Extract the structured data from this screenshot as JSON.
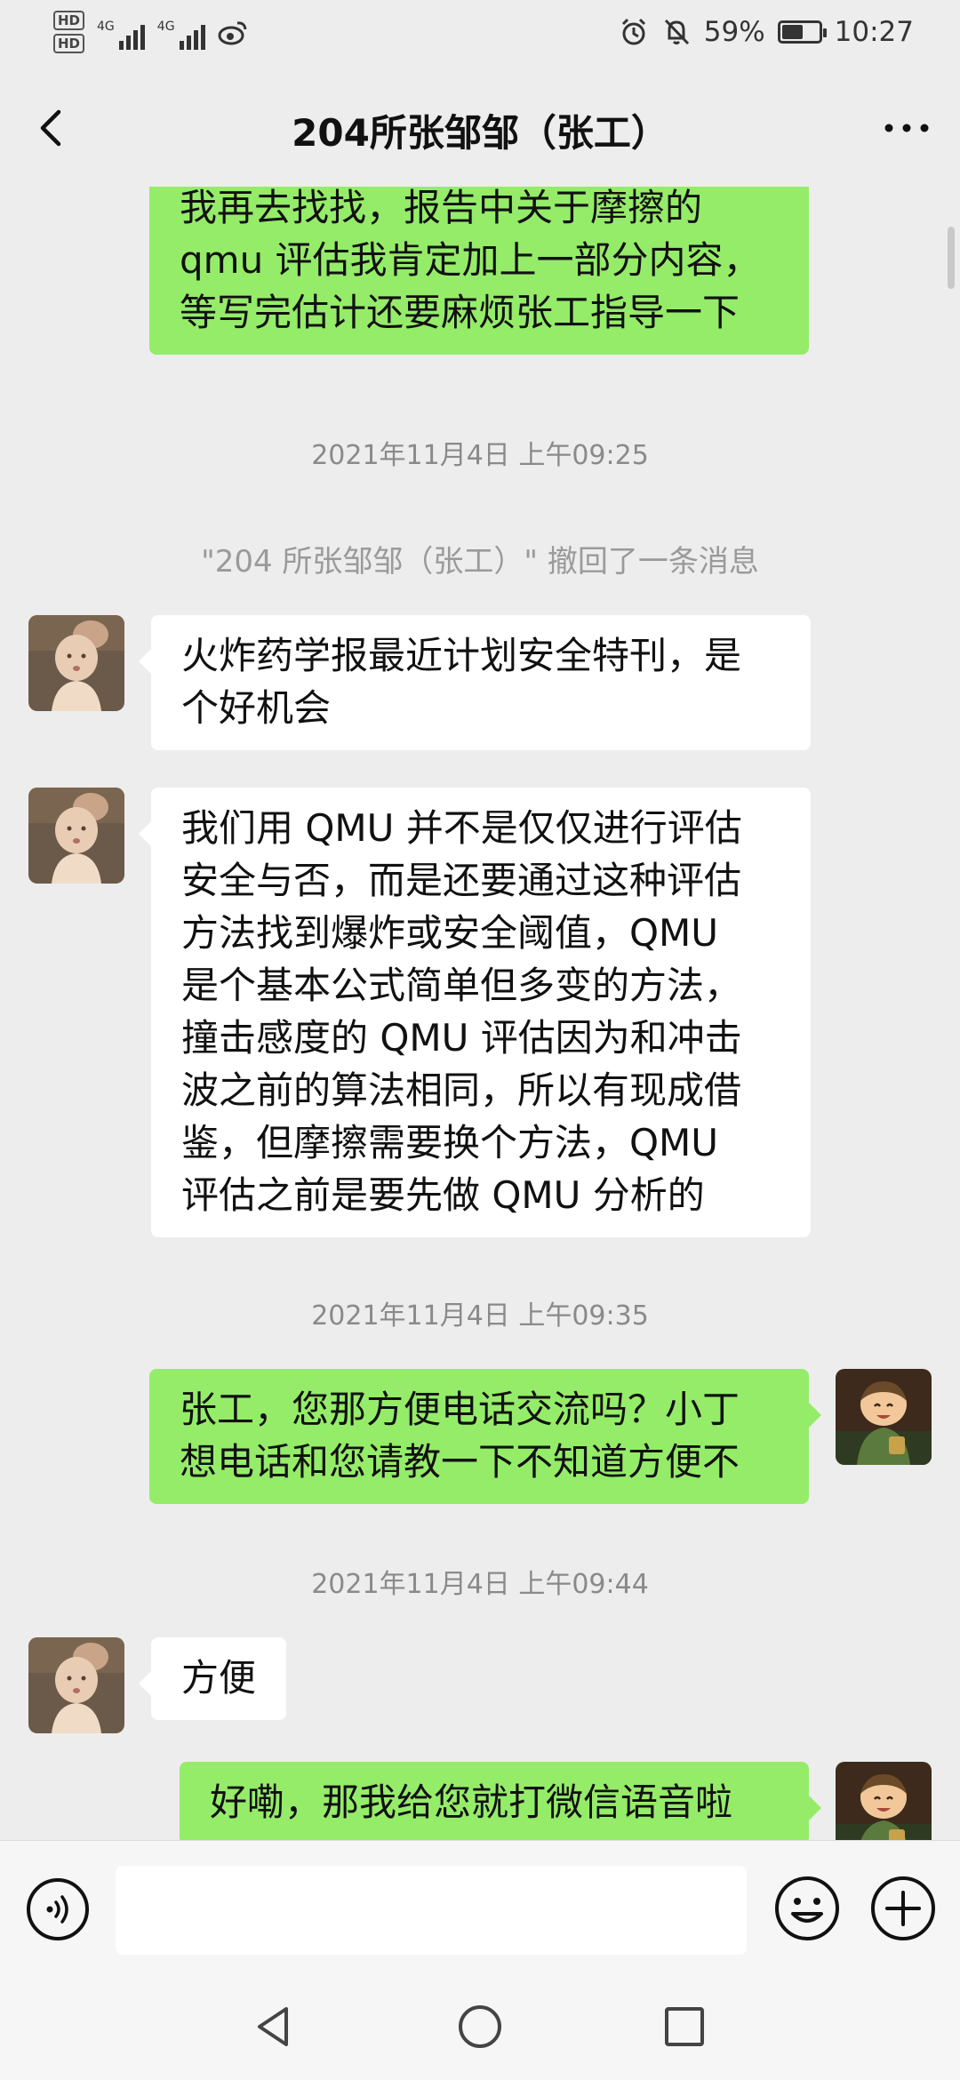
{
  "status": {
    "hd1": "HD",
    "hd2": "HD",
    "sig1_label": "4G",
    "sig2_label": "4G",
    "battery_percent": "59%",
    "battery_level": 0.59,
    "time": "10:27"
  },
  "header": {
    "title": "204所张邹邹（张工）"
  },
  "messages": {
    "m1": {
      "lines": [
        "我再去找找，报告中关于摩擦的",
        "qmu 评估我肯定加上一部分内容，",
        "等写完估计还要麻烦张工指导一下"
      ]
    },
    "ts1": "2021年11月4日 上午09:25",
    "recall": "\"204 所张邹邹（张工）\" 撤回了一条消息",
    "m2": {
      "lines": [
        "火炸药学报最近计划安全特刊，是",
        "个好机会"
      ]
    },
    "m3": {
      "lines": [
        "我们用 QMU 并不是仅仅进行评估",
        "安全与否，而是还要通过这种评估",
        "方法找到爆炸或安全阈值，QMU",
        "是个基本公式简单但多变的方法，",
        "撞击感度的 QMU 评估因为和冲击",
        "波之前的算法相同，所以有现成借",
        "鉴，但摩擦需要换个方法，QMU",
        "评估之前是要先做 QMU 分析的"
      ]
    },
    "ts2": "2021年11月4日 上午09:35",
    "m4": {
      "lines": [
        "张工，您那方便电话交流吗？小丁",
        "想电话和您请教一下不知道方便不"
      ]
    },
    "ts3": "2021年11月4日 上午09:44",
    "m5": {
      "lines": [
        "方便"
      ]
    },
    "m6": {
      "lines": [
        "好嘞，那我给您就打微信语音啦"
      ]
    }
  },
  "icons": {
    "back": "chevron-left-icon",
    "more": "more-dots-icon",
    "voice": "voice-icon",
    "emoji": "emoji-icon",
    "plus": "plus-icon"
  },
  "colors": {
    "sent_bubble": "#95ec69",
    "received_bubble": "#ffffff",
    "background": "#ededed"
  }
}
